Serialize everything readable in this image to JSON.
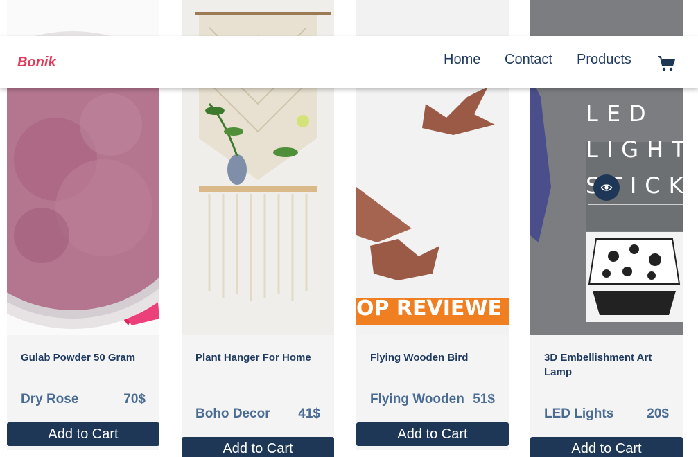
{
  "navbar": {
    "brand": "Bonik",
    "links": [
      {
        "label": "Home"
      },
      {
        "label": "Contact"
      },
      {
        "label": "Products"
      }
    ],
    "cart_icon": "shopping-cart-icon"
  },
  "products": [
    {
      "title": "Gulab Powder 50 Gram",
      "category": "Dry Rose",
      "price": "70$",
      "button": "Add to Cart",
      "image": "rose-powder-bowl"
    },
    {
      "title": "Plant Hanger For Home",
      "category": "Boho Decor",
      "price": "41$",
      "button": "Add to Cart",
      "image": "macrame-plant-hanger"
    },
    {
      "title": "Flying Wooden Bird",
      "category": "Flying Wooden",
      "price": "51$",
      "button": "Add to Cart",
      "image": "wooden-birds",
      "image_text": "OP REVIEWE"
    },
    {
      "title": "3D Embellishment Art Lamp",
      "category": "LED Lights",
      "price": "20$",
      "button": "Add to Cart",
      "image": "led-light-sticker",
      "image_text": [
        "LED",
        "LIGHT",
        "STICK"
      ],
      "quick_view_icon": "eye-icon"
    }
  ],
  "colors": {
    "primary": "#1e3756",
    "brand": "#e23b5a",
    "text": "#1f3a5f",
    "muted": "#4a6c93"
  }
}
